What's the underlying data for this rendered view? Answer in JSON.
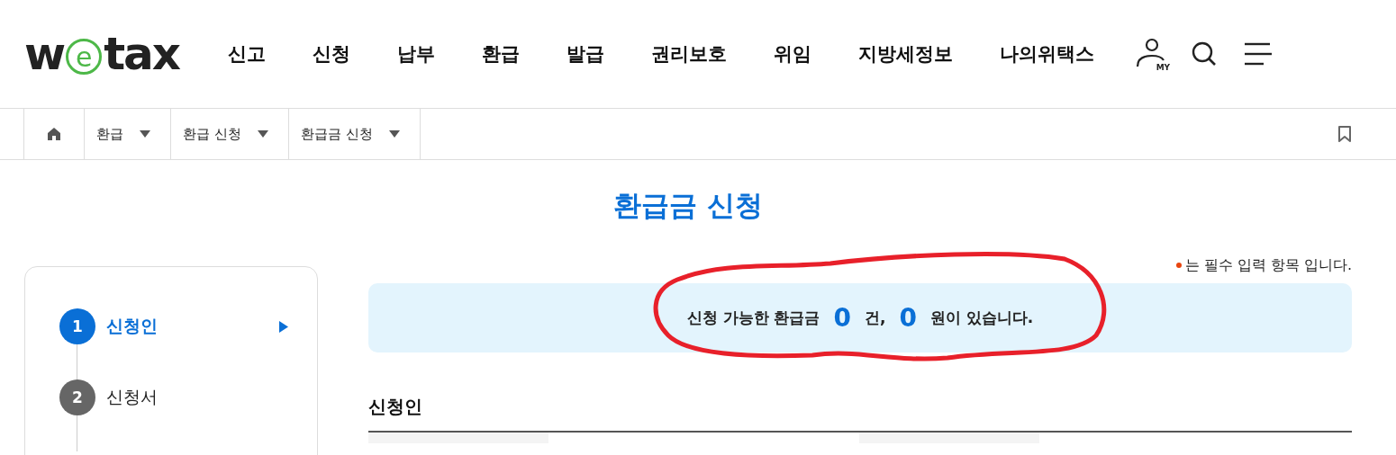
{
  "logo": {
    "before": "w",
    "circled": "e",
    "after": "tax"
  },
  "nav": [
    {
      "label": "신고"
    },
    {
      "label": "신청"
    },
    {
      "label": "납부"
    },
    {
      "label": "환급"
    },
    {
      "label": "발급"
    },
    {
      "label": "권리보호"
    },
    {
      "label": "위임"
    },
    {
      "label": "지방세정보"
    },
    {
      "label": "나의위택스"
    }
  ],
  "my_label": "MY",
  "breadcrumb": [
    {
      "label": "환급"
    },
    {
      "label": "환급 신청"
    },
    {
      "label": "환급금 신청"
    }
  ],
  "page_title": "환급금 신청",
  "required_note": "는 필수 입력 항목 입니다.",
  "steps": [
    {
      "number": "1",
      "label": "신청인",
      "selected": true
    },
    {
      "number": "2",
      "label": "신청서",
      "selected": false
    }
  ],
  "summary": {
    "prefix": "신청 가능한 환급금",
    "count": "0",
    "count_unit": "건,",
    "amount": "0",
    "amount_unit": "원이 있습니다."
  },
  "section_title": "신청인"
}
